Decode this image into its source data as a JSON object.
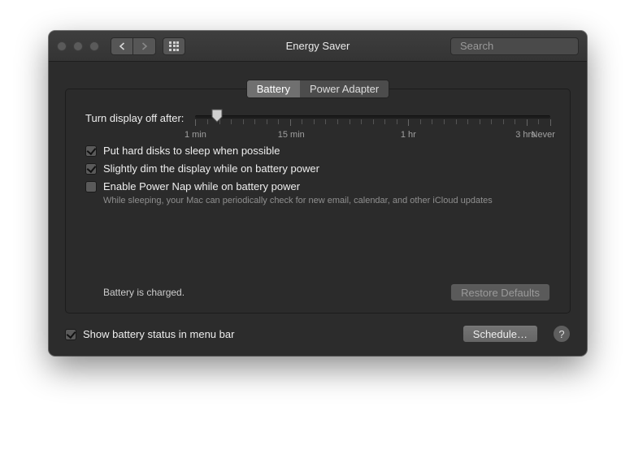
{
  "window": {
    "title": "Energy Saver",
    "search_placeholder": "Search"
  },
  "tabs": {
    "battery": "Battery",
    "power_adapter": "Power Adapter",
    "active": "battery"
  },
  "slider": {
    "label": "Turn display off after:",
    "value_percent": 6,
    "ticks": {
      "t0": "1 min",
      "t1": "15 min",
      "t2": "1 hr",
      "t3": "3 hrs",
      "t4": "Never"
    }
  },
  "checks": {
    "hard_disks": {
      "label": "Put hard disks to sleep when possible",
      "checked": true
    },
    "dim_display": {
      "label": "Slightly dim the display while on battery power",
      "checked": true
    },
    "power_nap": {
      "label": "Enable Power Nap while on battery power",
      "checked": false,
      "hint": "While sleeping, your Mac can periodically check for new email, calendar, and other iCloud updates"
    }
  },
  "status": "Battery is charged.",
  "buttons": {
    "restore_defaults": "Restore Defaults",
    "schedule": "Schedule…"
  },
  "footer": {
    "show_status": {
      "label": "Show battery status in menu bar",
      "checked": true
    }
  }
}
